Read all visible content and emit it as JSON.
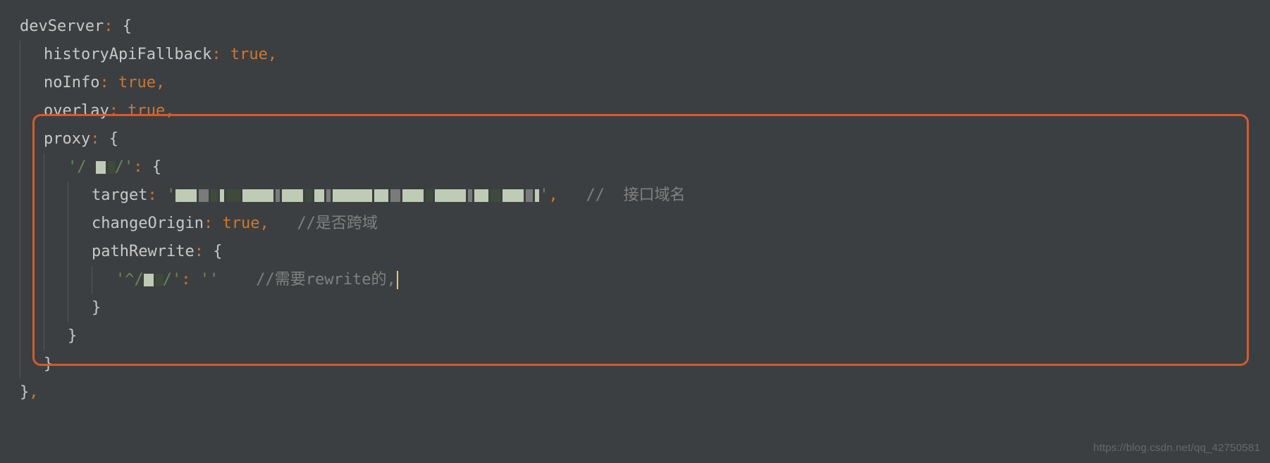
{
  "code": {
    "l1_prop": "devServer",
    "l2_prop": "historyApiFallback",
    "l2_val": "true",
    "l3_prop": "noInfo",
    "l3_val": "true",
    "l4_prop": "overlay",
    "l4_val": "true",
    "l5_prop": "proxy",
    "l6_key_open": "'/",
    "l6_key_close": "/'",
    "l7_prop": "target",
    "l7_str_open": "'",
    "l7_str_close": "'",
    "l7_comment": "//  接口域名",
    "l8_prop": "changeOrigin",
    "l8_val": "true",
    "l8_comment": "//是否跨域",
    "l9_prop": "pathRewrite",
    "l10_key_open": "'^/",
    "l10_key_close": "/'",
    "l10_val": "''",
    "l10_comment": "//需要rewrite的,",
    "brace_open": "{",
    "brace_close": "}",
    "colon": ":",
    "comma": ","
  },
  "watermark": "https://blog.csdn.net/qq_42750581"
}
